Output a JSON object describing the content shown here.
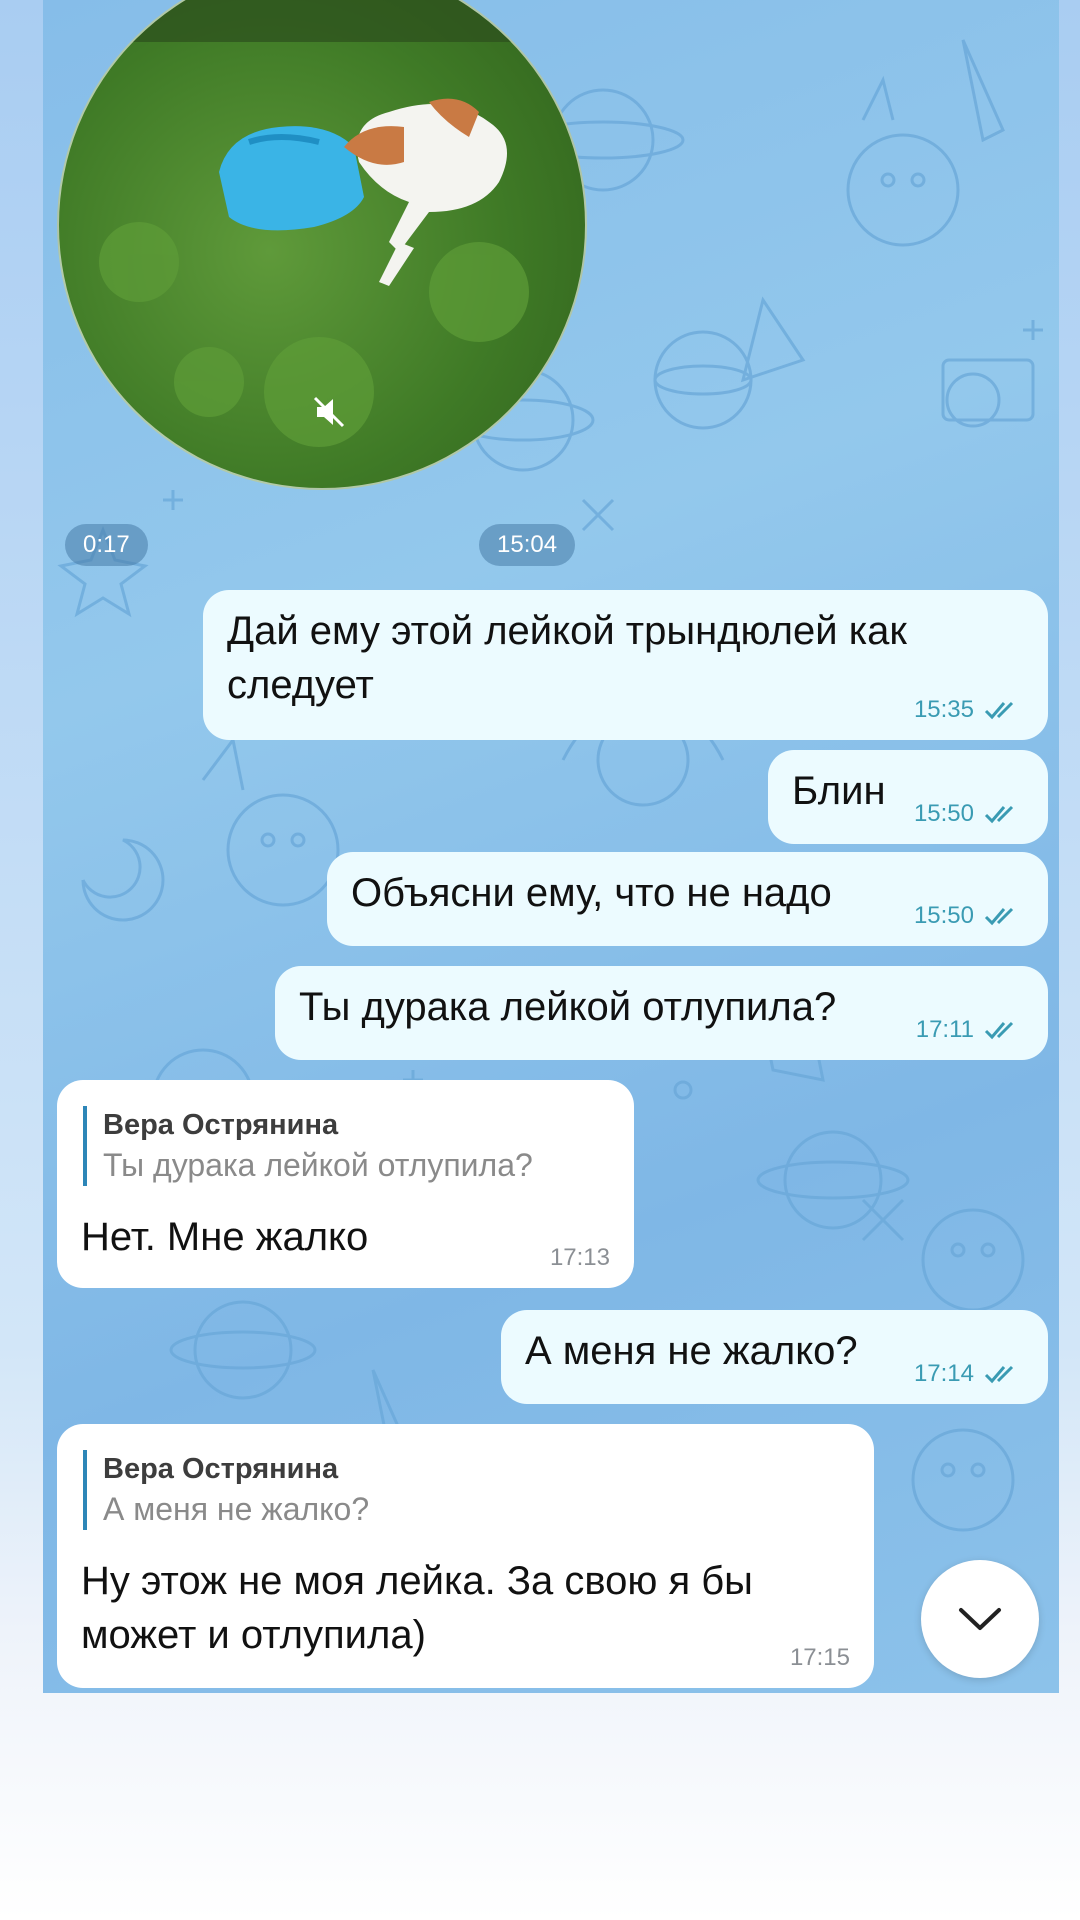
{
  "video": {
    "duration": "0:17",
    "time": "15:04"
  },
  "messages": [
    {
      "text": "Дай ему этой лейкой трындюлей как следует",
      "time": "15:35"
    },
    {
      "text": "Блин",
      "time": "15:50"
    },
    {
      "text": "Объясни ему, что не надо",
      "time": "15:50"
    },
    {
      "text": "Ты дурака лейкой отлупила?",
      "time": "17:11"
    },
    {
      "reply_name": "Вера Острянина",
      "reply_text": "Ты дурака лейкой отлупила?",
      "text": "Нет. Мне жалко",
      "time": "17:13"
    },
    {
      "text": "А меня не жалко?",
      "time": "17:14"
    },
    {
      "reply_name": "Вера Острянина",
      "reply_text": "А меня не жалко?",
      "text": "Ну этож не моя лейка. За свою я бы может и отлупила)",
      "time": "17:15"
    }
  ],
  "icons": {
    "read_receipt": "double-check-icon",
    "mute": "mute-icon",
    "scroll_down": "chevron-down-icon"
  },
  "colors": {
    "outgoing_bubble": "#ecfbff",
    "incoming_bubble": "#ffffff",
    "timestamp_outgoing": "#3a9bb3",
    "reply_bar": "#2d86b8"
  }
}
